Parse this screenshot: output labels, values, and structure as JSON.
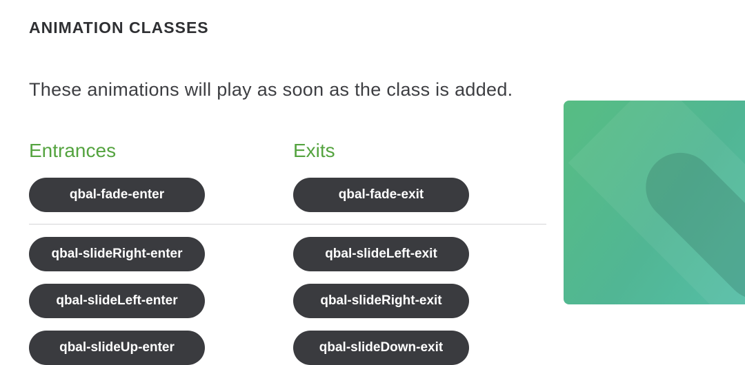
{
  "header": {
    "title": "ANIMATION CLASSES"
  },
  "intro": {
    "text": "These animations will play as soon as the class is added."
  },
  "entrances": {
    "heading": "Entrances",
    "primary": "qbal-fade-enter",
    "items": [
      "qbal-slideRight-enter",
      "qbal-slideLeft-enter",
      "qbal-slideUp-enter"
    ]
  },
  "exits": {
    "heading": "Exits",
    "primary": "qbal-fade-exit",
    "items": [
      "qbal-slideLeft-exit",
      "qbal-slideRight-exit",
      "qbal-slideDown-exit"
    ]
  },
  "colors": {
    "heading_green": "#54a33f",
    "button_bg": "#3a3b3f",
    "demo_gradient_start": "#57bd83",
    "demo_gradient_end": "#55bfa8"
  }
}
